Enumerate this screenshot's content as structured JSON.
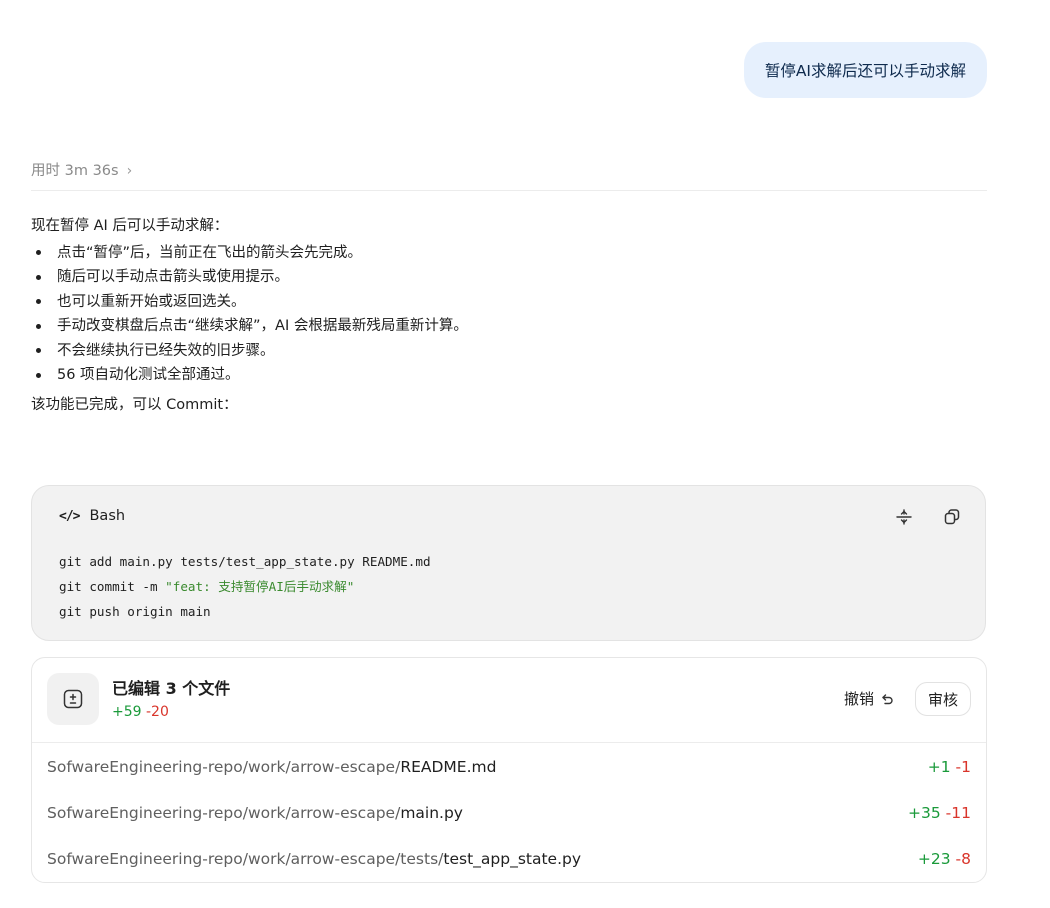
{
  "user_message": "暂停AI求解后还可以手动求解",
  "thinking": {
    "label": "用时 3m 36s",
    "chevron": "›"
  },
  "reply": {
    "intro": "现在暂停 AI 后可以手动求解：",
    "bullets": [
      "点击“暂停”后，当前正在飞出的箭头会先完成。",
      "随后可以手动点击箭头或使用提示。",
      "也可以重新开始或返回选关。",
      "手动改变棋盘后点击“继续求解”，AI 会根据最新残局重新计算。",
      "不会继续执行已经失效的旧步骤。",
      "56 项自动化测试全部通过。"
    ],
    "closing": "该功能已完成，可以 Commit："
  },
  "code_block": {
    "language": "Bash",
    "lang_icon": "</>",
    "line1": "git add main.py tests/test_app_state.py README.md",
    "line2_prefix": "git commit -m ",
    "line2_string": "\"feat: 支持暂停AI后手动求解\"",
    "line3": "git push origin main",
    "icons": [
      "collapse-icon",
      "copy-icon"
    ]
  },
  "files": {
    "title": "已编辑 3 个文件",
    "added": "+59",
    "removed": "-20",
    "undo_label": "撤销",
    "review_label": "审核",
    "rows": [
      {
        "dir": "SofwareEngineering-repo/work/arrow-escape/",
        "name": "README.md",
        "added": "+1",
        "removed": "-1"
      },
      {
        "dir": "SofwareEngineering-repo/work/arrow-escape/",
        "name": "main.py",
        "added": "+35",
        "removed": "-11"
      },
      {
        "dir": "SofwareEngineering-repo/work/arrow-escape/tests/",
        "name": "test_app_state.py",
        "added": "+23",
        "removed": "-8"
      }
    ]
  },
  "colors": {
    "user_bubble": "#e6f0fd",
    "code_bg": "#f2f2f2",
    "string_green": "#3a8a2e",
    "added_green": "#1a9a3a",
    "removed_red": "#d9352b"
  }
}
